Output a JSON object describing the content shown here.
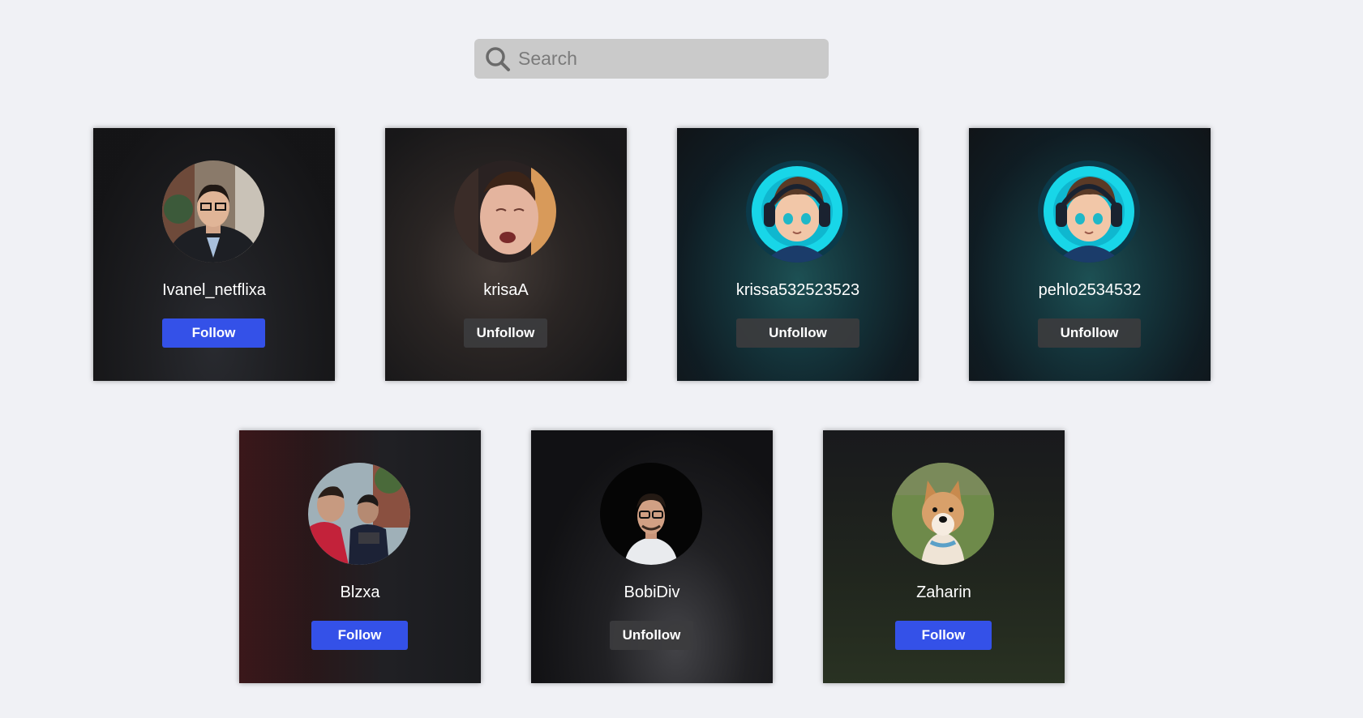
{
  "search": {
    "placeholder": "Search"
  },
  "users": [
    {
      "name": "Ivanel_netflixa",
      "button": "Follow"
    },
    {
      "name": "krisaA",
      "button": "Unfollow"
    },
    {
      "name": "krissa532523523",
      "button": "Unfollow"
    },
    {
      "name": "pehlo2534532",
      "button": "Unfollow"
    },
    {
      "name": "Blzxa",
      "button": "Follow"
    },
    {
      "name": "BobiDiv",
      "button": "Unfollow"
    },
    {
      "name": "Zaharin",
      "button": "Follow"
    }
  ],
  "colors": {
    "follow": "#3451e8",
    "unfollow": "#3c3c3e",
    "page_bg": "#f0f1f5",
    "card_bg": "#141416",
    "search_bg": "#cacaca"
  }
}
